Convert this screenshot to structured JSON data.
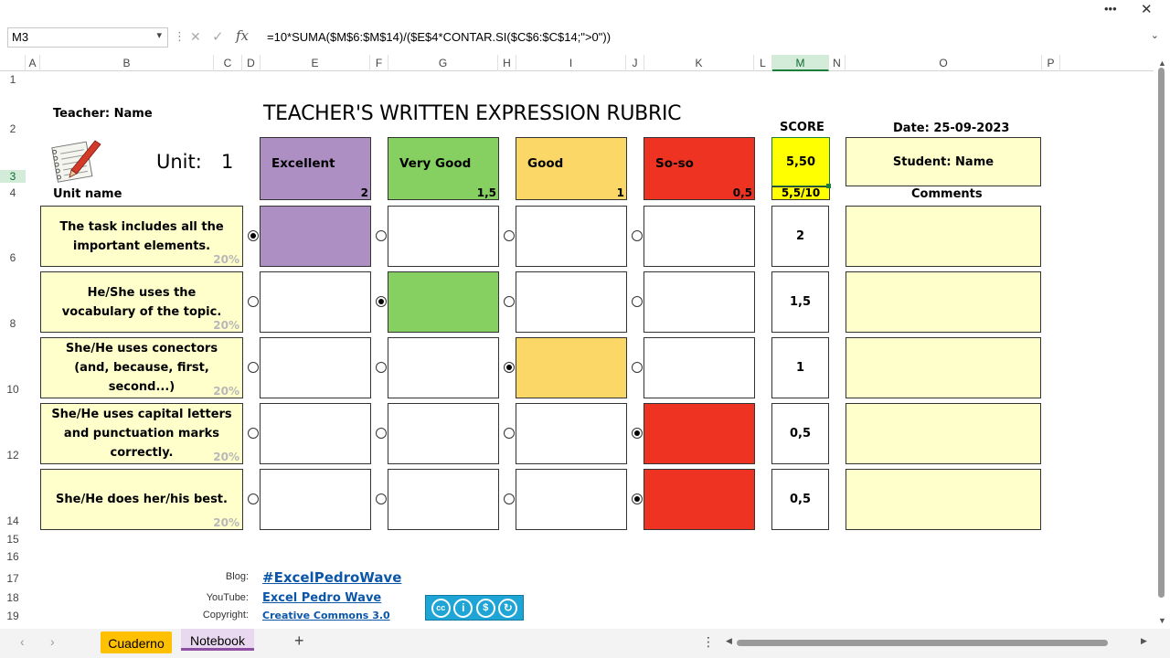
{
  "window": {
    "more_label": "•••",
    "close_label": "✕"
  },
  "formula_bar": {
    "name_box": "M3",
    "formula": "=10*SUMA($M$6:$M$14)/($E$4*CONTAR.SI($C$6:$C$14;\">0\"))",
    "cancel_label": "✕",
    "enter_label": "✓",
    "fx_label": "fx"
  },
  "columns": [
    "A",
    "B",
    "C",
    "D",
    "E",
    "F",
    "G",
    "H",
    "I",
    "J",
    "K",
    "L",
    "M",
    "N",
    "O",
    "P"
  ],
  "rows": [
    "1",
    "2",
    "3",
    "4",
    "6",
    "8",
    "10",
    "12",
    "14",
    "15",
    "16",
    "17",
    "18",
    "19"
  ],
  "sheet": {
    "teacher": "Teacher: Name",
    "title": "TEACHER'S WRITTEN EXPRESSION RUBRIC",
    "unit_label": "Unit:",
    "unit_value": "1",
    "unit_name": "Unit name",
    "score_header": "SCORE",
    "score_value": "5,50",
    "score_fraction": "5,5/10",
    "date": "Date: 25-09-2023",
    "student": "Student: Name",
    "comments_header": "Comments",
    "levels": [
      {
        "name": "Excellent",
        "points": "2",
        "color": "#ad8fc4"
      },
      {
        "name": "Very Good",
        "points": "1,5",
        "color": "#86d062"
      },
      {
        "name": "Good",
        "points": "1",
        "color": "#fbd767"
      },
      {
        "name": "So-so",
        "points": "0,5",
        "color": "#ef3322"
      }
    ],
    "criteria": [
      {
        "text": "The task includes all the\nimportant elements.",
        "pct": "20%",
        "selected": 0,
        "score": "2"
      },
      {
        "text": "He/She uses the\nvocabulary of the topic.",
        "pct": "20%",
        "selected": 1,
        "score": "1,5"
      },
      {
        "text": "She/He uses conectors\n(and, because, first,\nsecond...)",
        "pct": "20%",
        "selected": 2,
        "score": "1"
      },
      {
        "text": "She/He uses capital letters\nand punctuation marks\ncorrectly.",
        "pct": "20%",
        "selected": 3,
        "score": "0,5"
      },
      {
        "text": "She/He does her/his best.",
        "pct": "20%",
        "selected": 3,
        "score": "0,5"
      }
    ],
    "footer": {
      "blog_label": "Blog:",
      "blog_link": "#ExcelPedroWave",
      "youtube_label": "YouTube:",
      "youtube_link": "Excel Pedro Wave",
      "copyright_label": "Copyright:",
      "copyright_link": "Creative Commons 3.0"
    }
  },
  "tabs": [
    {
      "label": "Cuaderno",
      "active": false
    },
    {
      "label": "Notebook",
      "active": true
    }
  ],
  "add_sheet_label": "+"
}
